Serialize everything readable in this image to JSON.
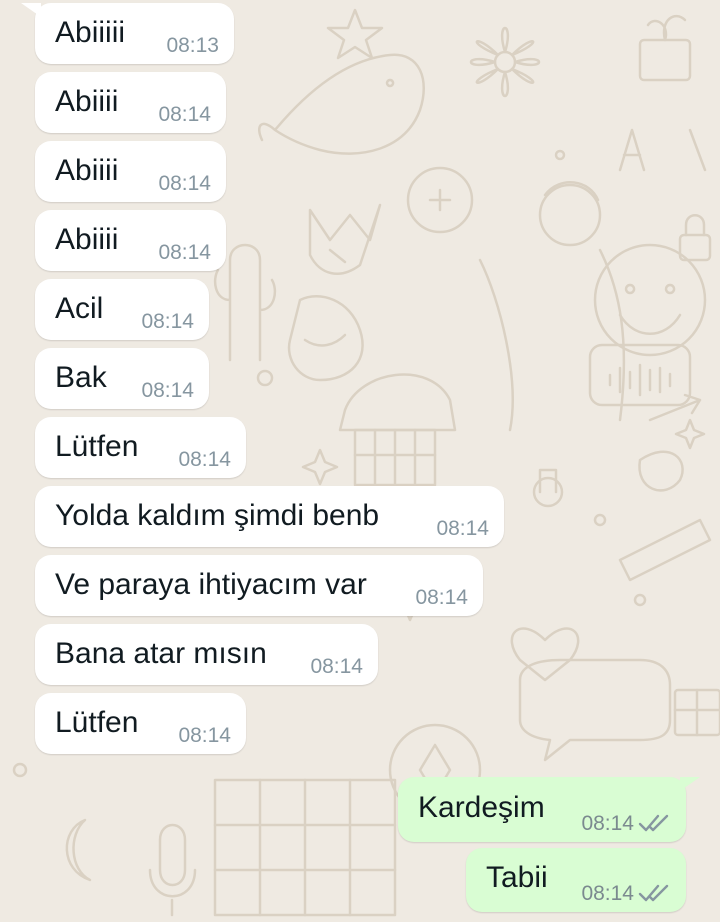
{
  "colors": {
    "background": "#efeae2",
    "incoming_bubble": "#ffffff",
    "outgoing_bubble": "#d9fdd3",
    "timestamp": "#8696a0"
  },
  "messages": [
    {
      "direction": "incoming",
      "text": "Abiiiii",
      "time": "08:13"
    },
    {
      "direction": "incoming",
      "text": "Abiiii",
      "time": "08:14"
    },
    {
      "direction": "incoming",
      "text": "Abiiii",
      "time": "08:14"
    },
    {
      "direction": "incoming",
      "text": "Abiiii",
      "time": "08:14"
    },
    {
      "direction": "incoming",
      "text": "Acil",
      "time": "08:14"
    },
    {
      "direction": "incoming",
      "text": "Bak",
      "time": "08:14"
    },
    {
      "direction": "incoming",
      "text": "Lütfen",
      "time": "08:14"
    },
    {
      "direction": "incoming",
      "text": "Yolda kaldım şimdi benb",
      "time": "08:14"
    },
    {
      "direction": "incoming",
      "text": "Ve paraya ihtiyacım var",
      "time": "08:14"
    },
    {
      "direction": "incoming",
      "text": "Bana atar mısın",
      "time": "08:14"
    },
    {
      "direction": "incoming",
      "text": "Lütfen",
      "time": "08:14"
    },
    {
      "direction": "outgoing",
      "text": "Kardeşim",
      "time": "08:14",
      "status": "double-check-icon"
    },
    {
      "direction": "outgoing",
      "text": "Tabii",
      "time": "08:14",
      "status": "double-check-icon"
    }
  ]
}
